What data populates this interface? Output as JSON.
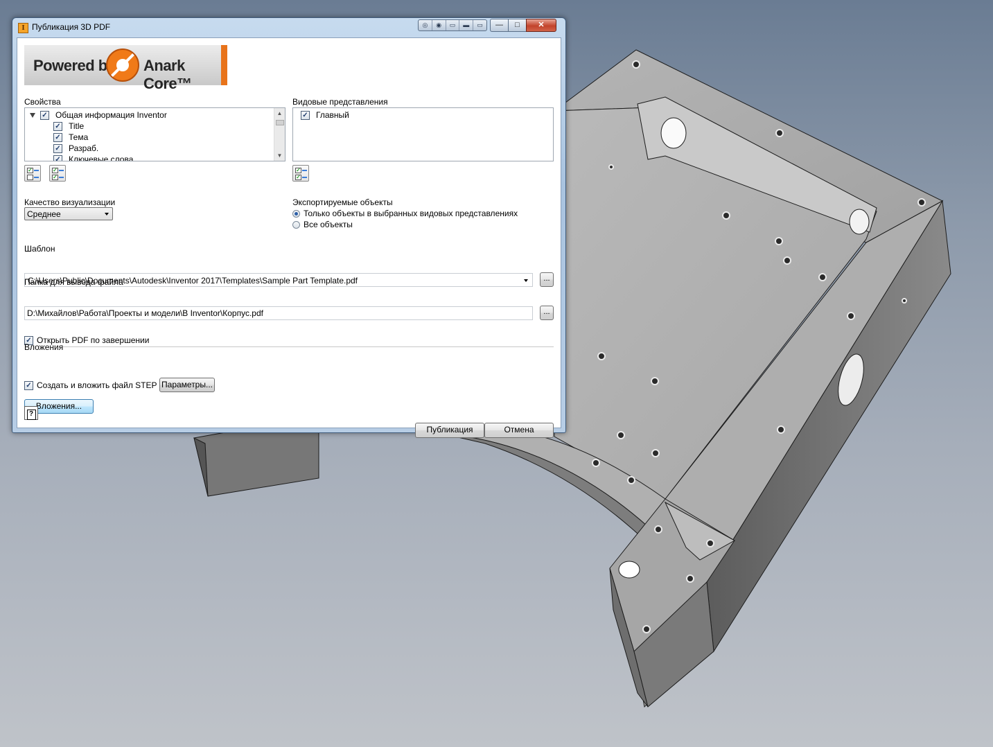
{
  "window": {
    "title": "Публикация 3D PDF",
    "extra_buttons": [
      "◎",
      "◉",
      "▭",
      "▬",
      "▭"
    ],
    "minimize": "—",
    "maximize": "□",
    "close": "✕"
  },
  "banner": {
    "powered_by": "Powered by",
    "brand": "Anark Core™"
  },
  "properties": {
    "label": "Свойства",
    "tree": [
      {
        "label": "Общая информация Inventor",
        "checked": true,
        "expanded": true
      },
      {
        "label": "Title",
        "checked": true
      },
      {
        "label": "Тема",
        "checked": true
      },
      {
        "label": "Разраб.",
        "checked": true
      },
      {
        "label": "Ключевые слова",
        "checked": true
      }
    ],
    "check_all_icon": "check-all-icon",
    "uncheck_icon": "check-list-icon"
  },
  "views": {
    "label": "Видовые представления",
    "items": [
      {
        "label": "Главный",
        "checked": true
      }
    ]
  },
  "quality": {
    "label": "Качество визуализации",
    "value": "Среднее"
  },
  "export": {
    "label": "Экспортируемые объекты",
    "options": [
      {
        "label": "Только объекты в выбранных видовых представлениях",
        "selected": true
      },
      {
        "label": "Все объекты",
        "selected": false
      }
    ]
  },
  "template": {
    "label": "Шаблон",
    "value": "C:\\Users\\Public\\Documents\\Autodesk\\Inventor 2017\\Templates\\Sample Part Template.pdf",
    "browse": "..."
  },
  "output": {
    "label": "Папка для вывода файла",
    "value": "D:\\Михайлов\\Работа\\Проекты и модели\\В Inventor\\Корпус.pdf",
    "browse": "..."
  },
  "open_pdf": {
    "label": "Открыть PDF по завершении",
    "checked": true
  },
  "attachments": {
    "label": "Вложения",
    "step_label": "Создать и вложить файл STEP",
    "step_checked": true,
    "params_button": "Параметры...",
    "attach_button": "Вложения..."
  },
  "footer": {
    "help": "?",
    "publish": "Публикация",
    "cancel": "Отмена"
  }
}
